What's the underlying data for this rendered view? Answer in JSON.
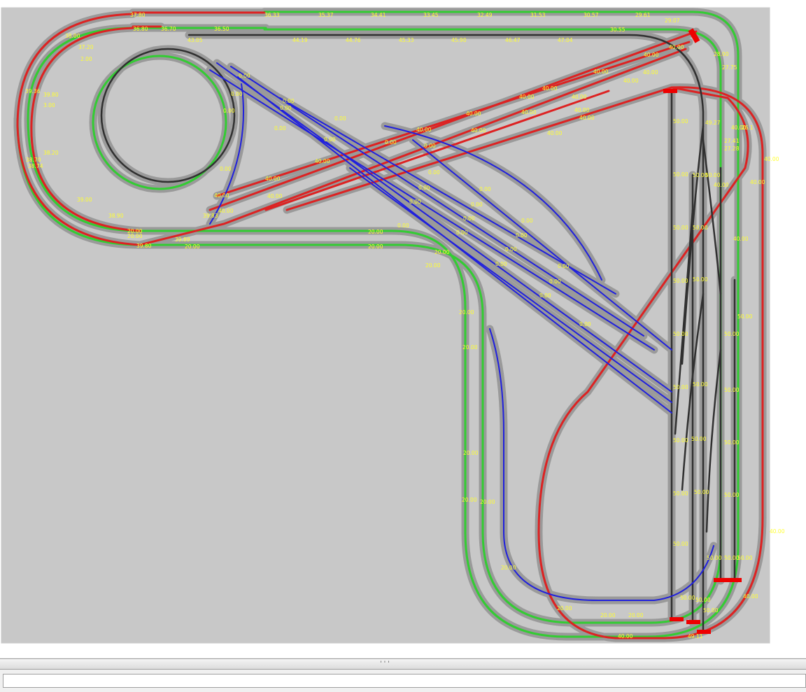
{
  "app": {
    "status_text": "",
    "scroll_grip": "'''"
  },
  "colors": {
    "canvas": "#c8c8c8",
    "bed": "#9a9a9a",
    "level_20": "#33cc33",
    "level_0": "#2020dd",
    "level_40": "#dd2222",
    "level_50": "#303030",
    "label": "#ffff33",
    "bumper": "#ee0000"
  },
  "labels": {
    "top_row": [
      "37.80",
      "36.33",
      "35.37",
      "34.41",
      "33.45",
      "32.49",
      "31.53",
      "30.57",
      "29.61",
      "29.07"
    ],
    "grey_row": [
      "43.05",
      "44.19",
      "44.76",
      "45.33",
      "45.90",
      "46.47",
      "47.04",
      "30.55"
    ],
    "left_loop": [
      "38.00",
      "37.20",
      "2.00",
      "39.36",
      "39.80",
      "3.00",
      "38.20",
      "38.70",
      "38.74",
      "39.00",
      "38.90",
      "36.80",
      "36.70",
      "36.50"
    ],
    "bottom_left": [
      "20.00",
      "39.89",
      "39.80",
      "20.00",
      "20.00"
    ],
    "red_ramp": [
      "40.00",
      "40.00",
      "40.00",
      "40.00",
      "40.00",
      "40.00",
      "40.00",
      "40.00",
      "40.00",
      "40.00",
      "40.00",
      "40.00",
      "40.00",
      "40.00",
      "40.00",
      "40.00",
      "40.00",
      "40.00",
      "40.00",
      "39.83",
      "40.00"
    ],
    "blue_fan": [
      "0.00",
      "0.00",
      "0.00",
      "0.00",
      "0.00",
      "0.00",
      "0.00",
      "0.00",
      "0.00",
      "0.00",
      "0.00",
      "0.00",
      "0.00",
      "0.00",
      "0.00",
      "0.00",
      "0.00",
      "0.00",
      "0.00",
      "0.00",
      "0.00",
      "0.00",
      "0.00",
      "0.00",
      "0.00",
      "0.00",
      "0.00"
    ],
    "green_path": [
      "20.00",
      "20.00",
      "20.00",
      "20.00",
      "20.00",
      "20.00",
      "20.00",
      "20.00",
      "20.00",
      "20.00",
      "20.00",
      "20.00",
      "20.00"
    ],
    "yard": [
      "50.00",
      "50.00",
      "50.00",
      "50.00",
      "50.00",
      "50.00",
      "50.00",
      "50.00",
      "50.00",
      "50.00",
      "50.00",
      "50.00",
      "50.00",
      "50.00",
      "50.00",
      "50.00",
      "50.00",
      "50.00",
      "50.00",
      "50.00",
      "50.00",
      "50.00",
      "50.00",
      "50.00",
      "50.00",
      "50.00",
      "50.00"
    ],
    "right_side": [
      "28.00",
      "27.75",
      "40.00",
      "26.1",
      "27.41",
      "27.28",
      "40.00",
      "40.00",
      "40.00",
      "40.00",
      "40.00",
      "40.00",
      "49.11",
      "49.27",
      "40.00"
    ]
  }
}
